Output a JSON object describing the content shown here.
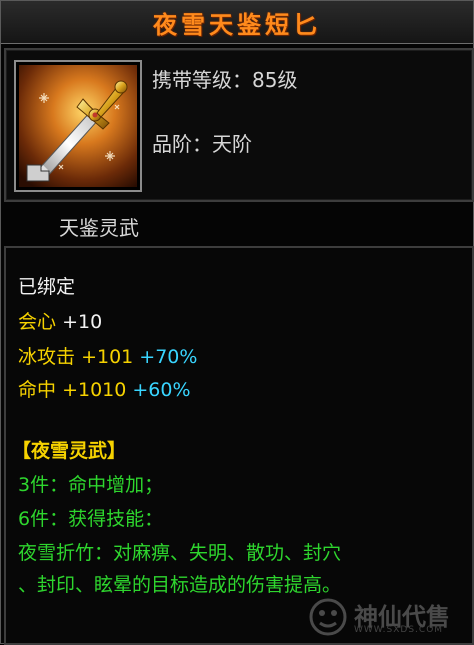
{
  "item": {
    "name": "夜雪天鉴短匕",
    "level_label": "携带等级：85级",
    "grade_label": "品阶：天阶",
    "category": "天鉴灵武",
    "icon": "golden-dagger-icon"
  },
  "attributes": {
    "bound": "已绑定",
    "crit": {
      "label": "会心",
      "value": "+10"
    },
    "ice_attack": {
      "label": "冰攻击",
      "value": "+101",
      "bonus": "+70%"
    },
    "accuracy": {
      "label": "命中",
      "value": "+1010",
      "bonus": "+60%"
    }
  },
  "set": {
    "name": "【夜雪灵武】",
    "bonus3": "3件：命中增加；",
    "bonus6": "6件：获得技能：",
    "skill_line1": "夜雪折竹：对麻痹、失明、散功、封穴",
    "skill_line2": "、封印、眩晕的目标造成的伤害提高。"
  },
  "watermark": {
    "text": "神仙代售",
    "url": "WWW.SXDS.COM"
  },
  "colors": {
    "title": "#ff8a1c",
    "attribute_name": "#f6d200",
    "bonus": "#39d5ff",
    "set_text": "#2ed62e",
    "base_text": "#f2f2f2"
  }
}
